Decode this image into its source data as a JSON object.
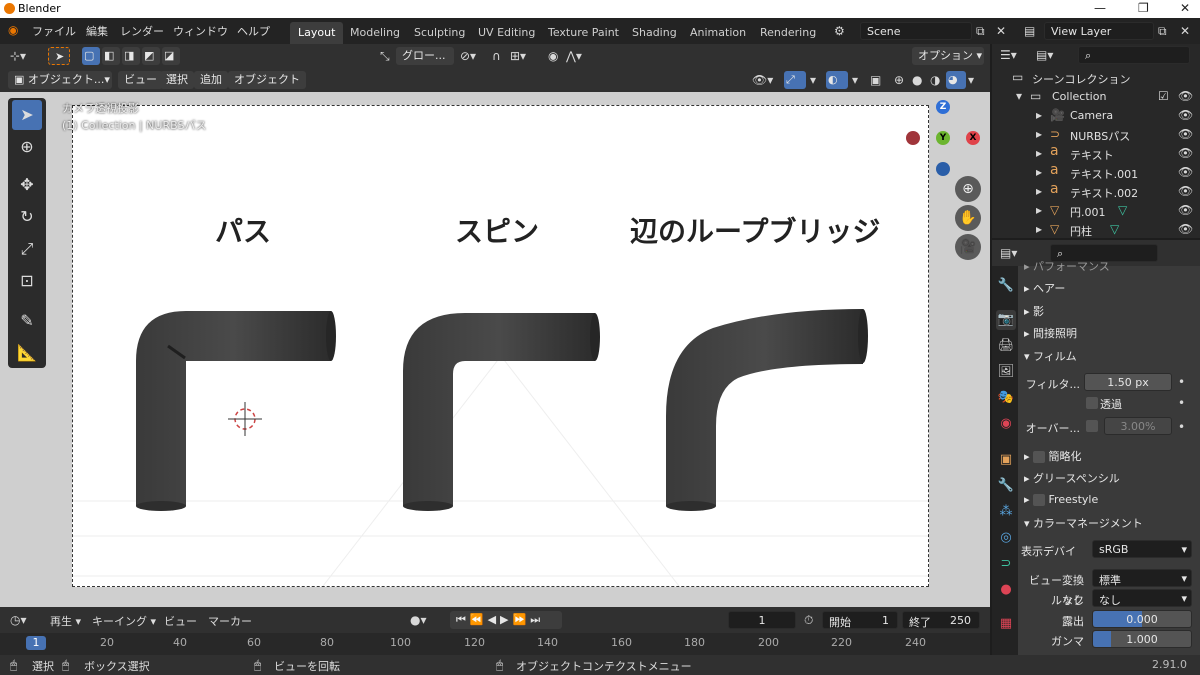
{
  "window": {
    "title": "Blender"
  },
  "menus": [
    "ファイル",
    "編集",
    "レンダー",
    "ウィンドウ",
    "ヘルプ"
  ],
  "workspaces": [
    "Layout",
    "Modeling",
    "Sculpting",
    "UV Editing",
    "Texture Paint",
    "Shading",
    "Animation",
    "Rendering"
  ],
  "active_workspace": "Layout",
  "scene": {
    "name": "Scene",
    "view_layer": "View Layer"
  },
  "header": {
    "transform": "グロー...",
    "options": "オプション",
    "mode": "オブジェクト...",
    "menu_view": "ビュー",
    "menu_select": "選択",
    "menu_add": "追加",
    "menu_object": "オブジェクト"
  },
  "viewport": {
    "info_line1": "カメラ透視投影",
    "info_line2": "(1) Collection | NURBSパス",
    "labels": [
      "パス",
      "スピン",
      "辺のループブリッジ"
    ],
    "axes": {
      "x": "X",
      "y": "Y",
      "z": "Z"
    }
  },
  "outliner": {
    "root": "シーンコレクション",
    "collection": "Collection",
    "items": [
      "Camera",
      "NURBSパス",
      "テキスト",
      "テキスト.001",
      "テキスト.002",
      "円.001",
      "円柱"
    ]
  },
  "properties": {
    "sections": {
      "performance": "パフォーマンス",
      "hair": "ヘアー",
      "shadow": "影",
      "indirect": "間接照明",
      "film": "フィルム",
      "simplify": "簡略化",
      "grease": "グリースペンシル",
      "freestyle": "Freestyle",
      "color": "カラーマネージメント"
    },
    "film": {
      "filter_label": "フィルタ...",
      "filter_value": "1.50 px",
      "transparent": "透過",
      "overscan_label": "オーバー...",
      "overscan_value": "3.00%"
    },
    "color": {
      "display_label": "表示デバイ",
      "display_value": "sRGB",
      "view_label": "ビュー変換",
      "view_value": "標準",
      "look_label": "ルック",
      "look_value": "なし",
      "exposure_label": "露出",
      "exposure_value": "0.000",
      "gamma_label": "ガンマ",
      "gamma_value": "1.000"
    }
  },
  "timeline": {
    "playback": "再生",
    "keying": "キーイング",
    "view": "ビュー",
    "marker": "マーカー",
    "current_frame": "1",
    "start_label": "開始",
    "start": "1",
    "end_label": "終了",
    "end": "250",
    "ticks": [
      "1",
      "20",
      "40",
      "60",
      "80",
      "100",
      "120",
      "140",
      "160",
      "180",
      "200",
      "220",
      "240"
    ]
  },
  "status": {
    "select": "選択",
    "box_select": "ボックス選択",
    "rotate_view": "ビューを回転",
    "context_menu": "オブジェクトコンテクストメニュー",
    "version": "2.91.0"
  },
  "colors": {
    "accent": "#4772b3",
    "background": "#1d1d1d"
  }
}
